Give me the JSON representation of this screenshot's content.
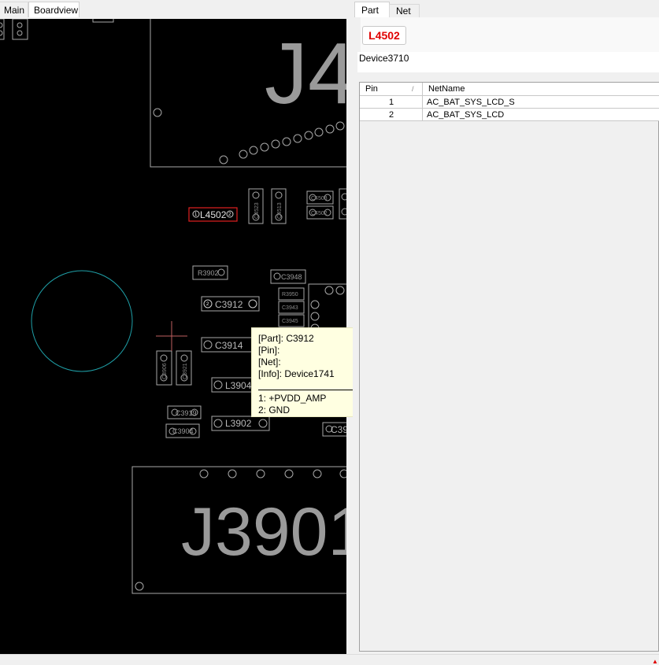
{
  "tabs": {
    "main": "Main",
    "boardview": "Boardview"
  },
  "right_tabs": {
    "part": "Part",
    "net": "Net"
  },
  "selected_part": {
    "name": "L4502",
    "info": "Device3710"
  },
  "grid": {
    "headers": {
      "pin": "Pin",
      "sort_glyph": "/",
      "netname": "NetName"
    },
    "rows": [
      {
        "pin": "1",
        "net": "AC_BAT_SYS_LCD_S"
      },
      {
        "pin": "2",
        "net": "AC_BAT_SYS_LCD"
      }
    ]
  },
  "board": {
    "big_labels": {
      "j4": "J4",
      "j3901": "J3901"
    },
    "parts": {
      "l4502": "L4502",
      "r3902": "R3902",
      "c3912": "C3912",
      "c3914": "C3914",
      "l3904": "L3904",
      "l3902": "L3902",
      "c3948": "C3948",
      "c3919": "C3919",
      "c3904": "C3904",
      "c3906": "C3906",
      "c3921": "C3921",
      "c4523": "C4523",
      "c4513": "C4513",
      "c4503": "C4503",
      "c4502": "C4502",
      "c39x": "C39",
      "r3950": "R3950",
      "c3943": "C3943",
      "c3945": "C3945"
    },
    "pins": {
      "p1": "1",
      "p2": "2"
    },
    "colors": {
      "outline": "#a8a8a8",
      "selected": "#e02020",
      "circle": "#1fa0a8",
      "cross": "#c06060"
    }
  },
  "tooltip": {
    "part": "[Part]: C3912",
    "pin": "[Pin]:",
    "net": "[Net]:",
    "info": "[Info]: Device1741",
    "pin1": "1: +PVDD_AMP",
    "pin2": "2: GND"
  }
}
